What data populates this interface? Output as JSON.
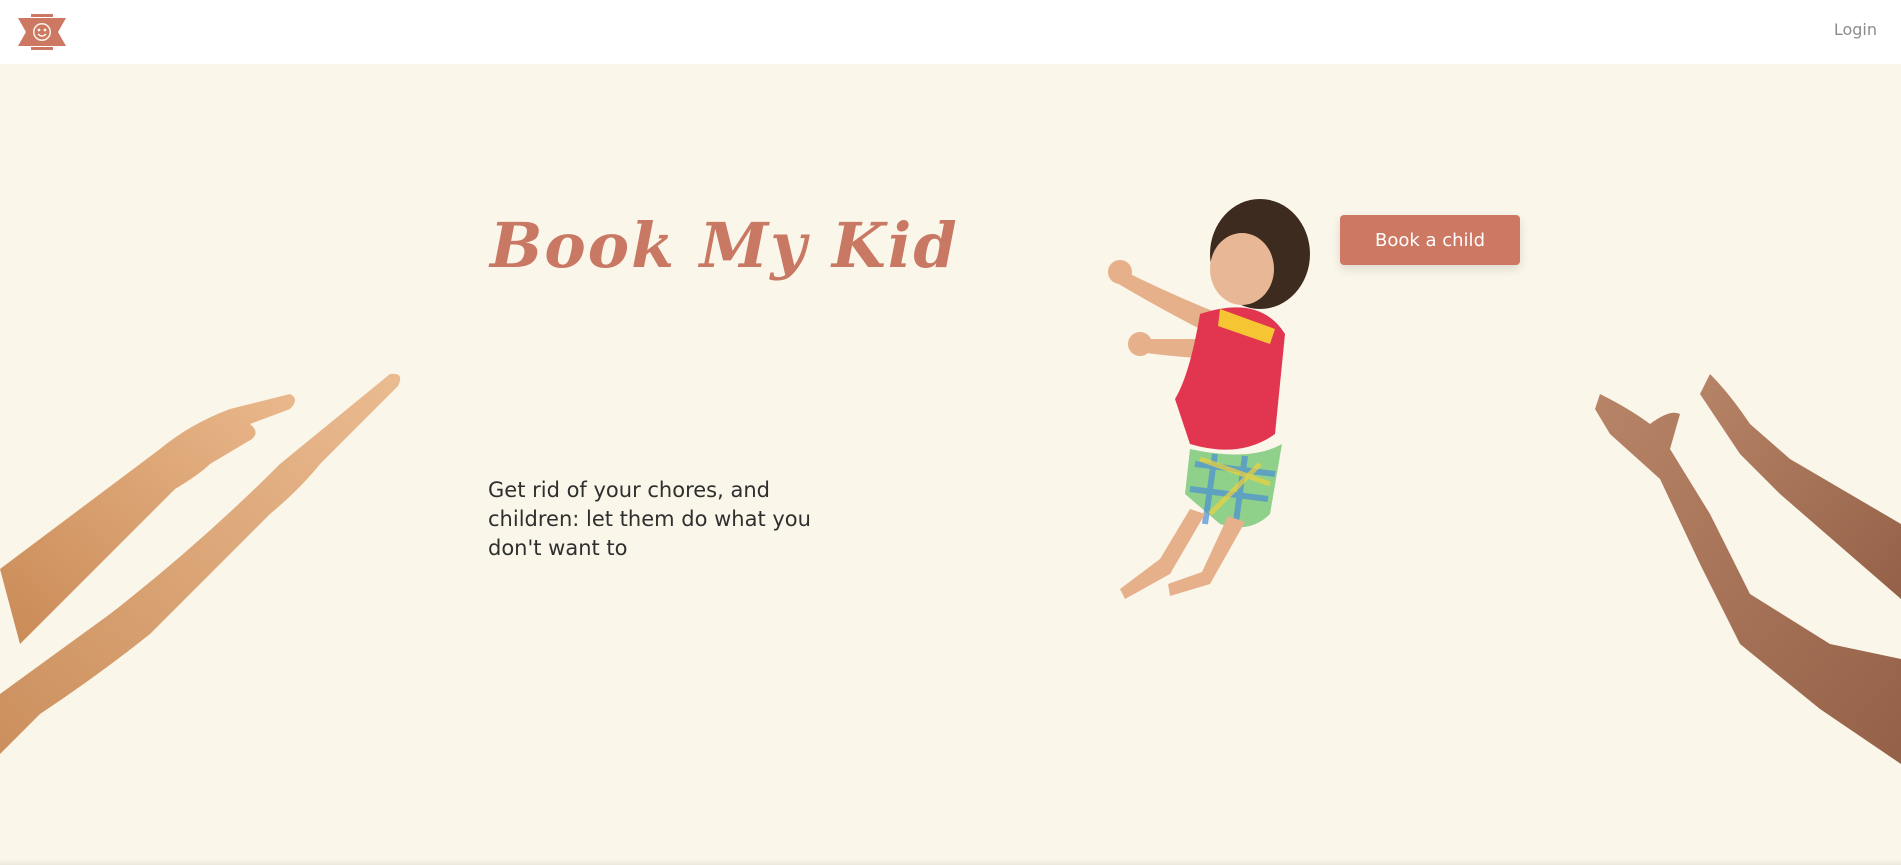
{
  "header": {
    "logo_icon": "kid-face-bowtie-icon",
    "login_label": "Login"
  },
  "hero": {
    "title": "Book My Kid",
    "tagline": "Get rid of your chores, and children: let them do what you don't want to",
    "cta_label": "Book a child"
  },
  "colors": {
    "accent": "#cd7863",
    "title": "#c97864",
    "background": "#faf6e9",
    "header_bg": "#ffffff",
    "text": "#2f2f2f",
    "login_text": "#8c8c8c"
  },
  "illustrations": {
    "left": "reaching-arms-left",
    "center": "jumping-child",
    "right": "reaching-arms-right"
  }
}
